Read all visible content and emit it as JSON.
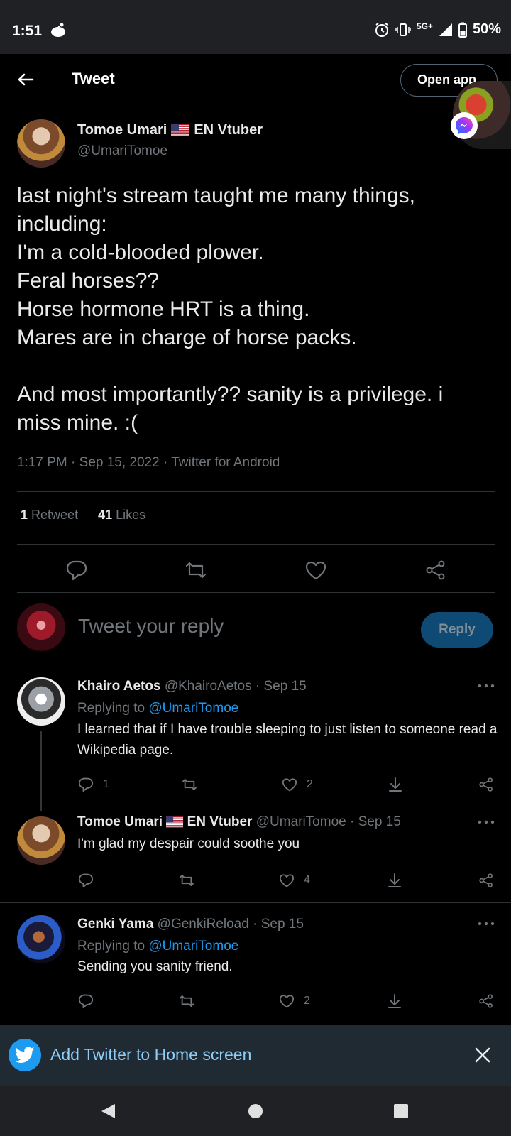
{
  "status_bar": {
    "time": "1:51",
    "network": "5G+",
    "battery": "50%"
  },
  "header": {
    "title": "Tweet",
    "open_app": "Open app"
  },
  "tweet": {
    "author_name": "Tomoe Umari",
    "author_suffix": "EN Vtuber",
    "author_handle": "@UmariTomoe",
    "lines": [
      "last night's stream taught me many things,",
      "including:",
      "I'm a cold-blooded plower.",
      "Feral horses??",
      "Horse hormone HRT is a thing.",
      "Mares are in charge of horse packs.",
      "",
      "And most importantly?? sanity is a privilege. i",
      "miss mine. :("
    ],
    "meta": "1:17 PM · Sep 15, 2022 · Twitter for Android",
    "retweet_count": "1",
    "retweet_label": "Retweet",
    "like_count": "41",
    "like_label": "Likes"
  },
  "reply_box": {
    "placeholder": "Tweet your reply",
    "button": "Reply"
  },
  "replies": [
    {
      "name": "Khairo Aetos",
      "handle": "@KhairoAetos",
      "date": "· Sep 15",
      "replying_prefix": "Replying to",
      "replying_to": "@UmariTomoe",
      "text": "I learned that if I have trouble sleeping to just listen to someone read a Wikipedia page.",
      "reply_count": "1",
      "like_count": "2"
    },
    {
      "name": "Tomoe Umari",
      "name_suffix": "EN Vtuber",
      "handle": "@UmariTomoe",
      "date": "· Sep 15",
      "text": "I'm glad my despair could soothe you",
      "reply_count": "",
      "like_count": "4"
    },
    {
      "name": "Genki Yama",
      "handle": "@GenkiReload",
      "date": "· Sep 15",
      "replying_prefix": "Replying to",
      "replying_to": "@UmariTomoe",
      "text": "Sending you sanity friend.",
      "reply_count": "",
      "like_count": "2"
    }
  ],
  "install_banner": {
    "label": "Add Twitter to Home screen"
  },
  "icons": {
    "back": "back-arrow-icon",
    "reply": "reply-icon",
    "retweet": "retweet-icon",
    "like": "heart-icon",
    "share": "share-icon",
    "more": "more-icon",
    "download": "download-icon"
  },
  "colors": {
    "background": "#000000",
    "link": "#1d9bf0",
    "muted": "#71767b",
    "reply_button": "#0e4a74"
  }
}
